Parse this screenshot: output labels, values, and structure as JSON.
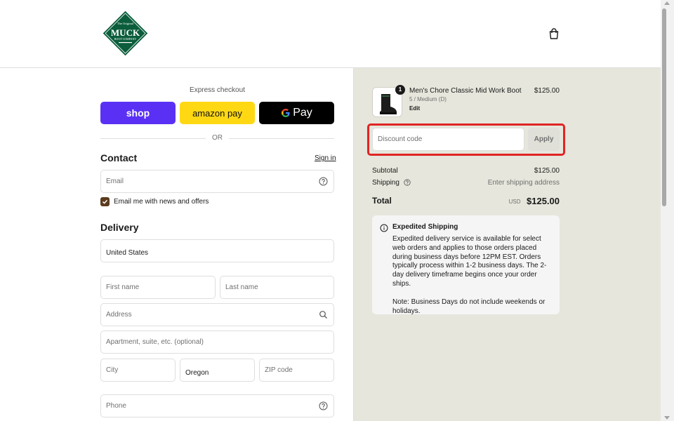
{
  "brand": {
    "logo_lines": [
      "The Original",
      "MUCK",
      "BOOT COMPANY"
    ],
    "logo_color": "#0b5d3b"
  },
  "header": {
    "cart_icon": "bag-icon"
  },
  "express": {
    "label": "Express checkout",
    "shop_label": "shop",
    "amazon_label": "amazon pay",
    "gpay_label": "Pay",
    "or_label": "OR",
    "colors": {
      "shop": "#5a31f4",
      "amazon": "#ffd814",
      "gpay": "#000000"
    }
  },
  "contact": {
    "title": "Contact",
    "signin_label": "Sign in",
    "email_placeholder": "Email",
    "newsletter_label": "Email me with news and offers",
    "newsletter_checked": true
  },
  "delivery": {
    "title": "Delivery",
    "country_value": "United States",
    "first_name_placeholder": "First name",
    "last_name_placeholder": "Last name",
    "address_placeholder": "Address",
    "apartment_placeholder": "Apartment, suite, etc. (optional)",
    "city_placeholder": "City",
    "state_value": "Oregon",
    "zip_placeholder": "ZIP code",
    "phone_placeholder": "Phone"
  },
  "order": {
    "product": {
      "quantity": "1",
      "name": "Men's Chore Classic Mid Work Boot",
      "variant": "5 / Medium (D)",
      "edit_label": "Edit",
      "price": "$125.00"
    },
    "discount_placeholder": "Discount code",
    "apply_label": "Apply",
    "highlight_color": "#e02424",
    "subtotal_label": "Subtotal",
    "subtotal_value": "$125.00",
    "shipping_label": "Shipping",
    "shipping_value": "Enter shipping address",
    "total_label": "Total",
    "total_currency": "USD",
    "total_value": "$125.00"
  },
  "notice": {
    "title": "Expedited Shipping",
    "paragraph1": "Expedited delivery service is available for select web orders and applies to those orders placed during business days before 12PM EST. Orders typically process within 1-2 business days. The 2-day delivery timeframe begins once your order ships.",
    "paragraph2": "Note: Business Days do not include weekends or holidays."
  }
}
